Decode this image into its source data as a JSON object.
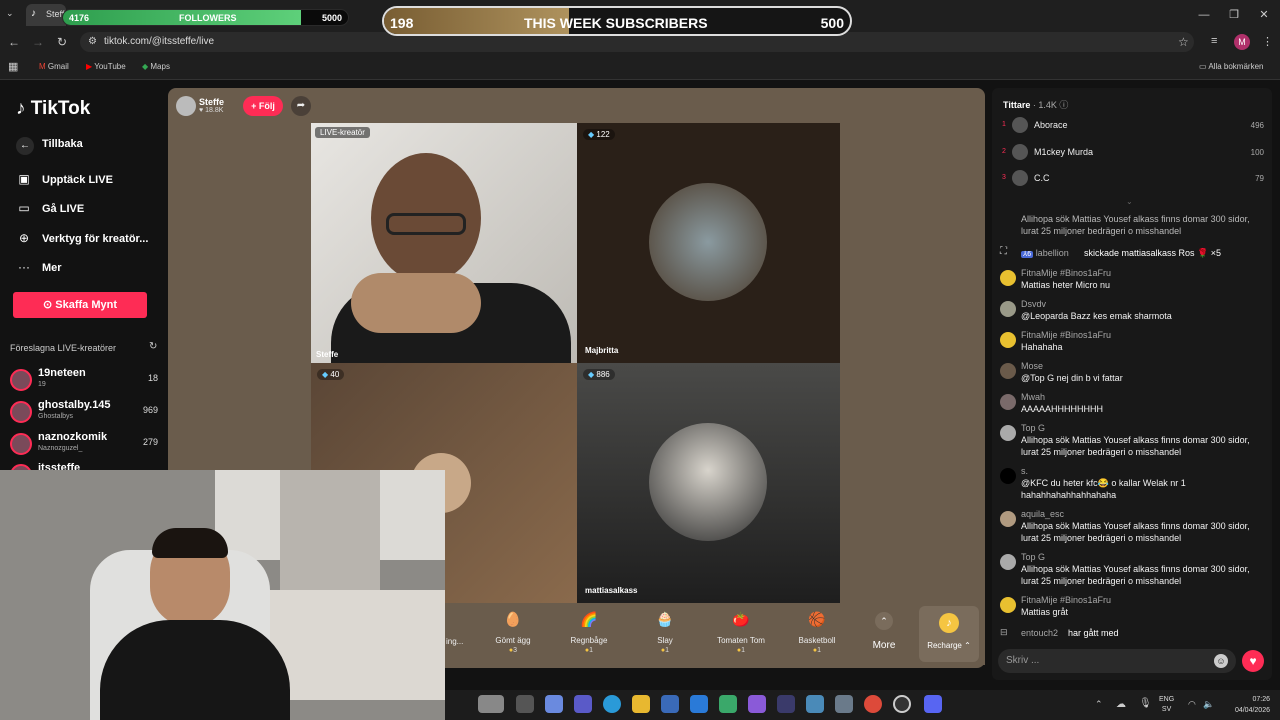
{
  "browser": {
    "tab_title": "Steffe",
    "url": "tiktok.com/@itssteffe/live",
    "bookmarks": [
      "Gmail",
      "YouTube",
      "Maps"
    ],
    "all_bookmarks": "Alla bokmärken",
    "profile_initial": "M"
  },
  "overlay": {
    "followers_current": "4176",
    "followers_label": "FOLLOWERS",
    "followers_goal": "5000",
    "followers_progress": 0.835,
    "subs_current": "198",
    "subs_label": "THIS WEEK SUBSCRIBERS",
    "subs_goal": "500",
    "subs_progress": 0.396
  },
  "sidebar": {
    "logo": "TikTok",
    "back": "Tillbaka",
    "nav": [
      "Upptäck LIVE",
      "Gå LIVE",
      "Verktyg för kreatör...",
      "Mer"
    ],
    "get_coins": "Skaffa Mynt",
    "suggested_title": "Föreslagna LIVE-kreatörer",
    "suggested": [
      {
        "name": "19neteen",
        "sub": "19",
        "count": "18"
      },
      {
        "name": "ghostalby.145",
        "sub": "Ghostalbys",
        "count": "969"
      },
      {
        "name": "naznozkomik",
        "sub": "Naznozguzel_",
        "count": "279"
      },
      {
        "name": "itssteffe",
        "sub": "",
        "count": ""
      }
    ]
  },
  "stream": {
    "host_name": "Steffe",
    "host_likes": "18.8K",
    "follow_label": "+ Följ",
    "tiles": [
      {
        "badge": "LIVE-kreatör",
        "name": "Steffe"
      },
      {
        "badge": "122",
        "name": "Majbritta"
      },
      {
        "badge": "40",
        "name": ""
      },
      {
        "badge": "886",
        "name": "mattiasalkass"
      }
    ],
    "gifts": [
      {
        "name": "Gömt ägg",
        "price": "3",
        "icon": "🥚"
      },
      {
        "name": "Regnbåge",
        "price": "1",
        "icon": "🌈"
      },
      {
        "name": "Slay",
        "price": "1",
        "icon": "🧁"
      },
      {
        "name": "Tomaten Tom",
        "price": "1",
        "icon": "🍅"
      },
      {
        "name": "Basketboll",
        "price": "1",
        "icon": "🏀"
      }
    ],
    "partial_gift": "ing...",
    "more": "More",
    "recharge": "Recharge"
  },
  "chat": {
    "viewers_title": "Tittare",
    "viewers_count": "1.4K",
    "top_viewers": [
      {
        "rank": "1",
        "name": "Aborace",
        "score": "496"
      },
      {
        "rank": "2",
        "name": "M1ckey Murda",
        "score": "100"
      },
      {
        "rank": "3",
        "name": "C.C",
        "score": "79"
      }
    ],
    "messages": [
      {
        "user": "",
        "text": "Allihopa sök Mattias Yousef alkass finns domar 300 sidor, lurat 25 miljoner bedrägeri o misshandel"
      },
      {
        "user": "labellion",
        "text": "skickade mattiasalkass  Ros 🌹 ×5"
      },
      {
        "user": "FitnaMije #Binos1aFru",
        "text": "Mattias heter Micro nu"
      },
      {
        "user": "Dsvdv",
        "text": "@Leoparda Bazz kes emak sharmota"
      },
      {
        "user": "FitnaMije #Binos1aFru",
        "text": "Hahahaha"
      },
      {
        "user": "Mose",
        "text": "@Top G nej din b vi fattar"
      },
      {
        "user": "Mwah",
        "text": "AAAAAHHHHHHHH"
      },
      {
        "user": "Top G",
        "text": "Allihopa sök Mattias Yousef alkass finns domar 300 sidor, lurat 25 miljoner bedrägeri o misshandel"
      },
      {
        "user": "s.",
        "text": "@KFC du heter kfc😂 o kallar Welak nr 1 hahahhahahhahhahaha"
      },
      {
        "user": "aquila_esc",
        "text": "Allihopa sök Mattias Yousef alkass finns domar 300 sidor, lurat 25 miljoner bedrägeri o misshandel"
      },
      {
        "user": "Top G",
        "text": "Allihopa sök Mattias Yousef alkass finns domar 300 sidor, lurat 25 miljoner bedrägeri o misshandel"
      },
      {
        "user": "FitnaMije #Binos1aFru",
        "text": "Mattias gråt"
      },
      {
        "user": "entouch2",
        "text": "har gått med"
      }
    ],
    "input_placeholder": "Skriv ..."
  },
  "taskbar": {
    "lang": "ENG",
    "region": "SV",
    "time": "07:26",
    "date": "04/04/2026"
  },
  "colors": {
    "accent": "#fe2c55",
    "stage": "#6a5c4c"
  }
}
